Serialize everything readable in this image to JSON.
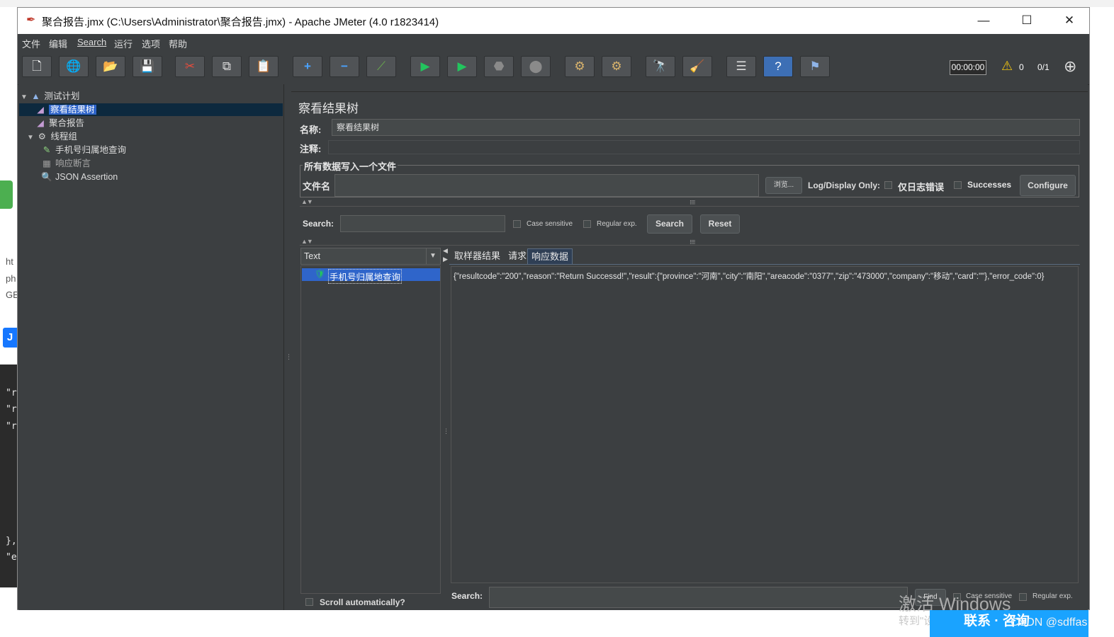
{
  "window": {
    "title": "聚合报告.jmx (C:\\Users\\Administrator\\聚合报告.jmx) - Apache JMeter (4.0 r1823414)",
    "controls": {
      "minimize": "—",
      "maximize": "☐",
      "close": "✕"
    }
  },
  "menu": [
    "文件",
    "编辑",
    "Search",
    "运行",
    "选项",
    "帮助"
  ],
  "toolbar": {
    "buttons": [
      {
        "name": "new-icon",
        "glyph": "🗋"
      },
      {
        "name": "templates-icon",
        "glyph": "🌐"
      },
      {
        "name": "open-icon",
        "glyph": "📂"
      },
      {
        "name": "save-icon",
        "glyph": "💾"
      },
      {
        "name": "cut-icon",
        "glyph": "✂"
      },
      {
        "name": "copy-icon",
        "glyph": "⧉"
      },
      {
        "name": "paste-icon",
        "glyph": "📋"
      },
      {
        "name": "expand-icon",
        "glyph": "+"
      },
      {
        "name": "collapse-icon",
        "glyph": "−"
      },
      {
        "name": "toggle-icon",
        "glyph": "⟋"
      },
      {
        "name": "start-icon",
        "glyph": "▶"
      },
      {
        "name": "start-no-pauses-icon",
        "glyph": "▶"
      },
      {
        "name": "stop-icon",
        "glyph": "⬣"
      },
      {
        "name": "shutdown-icon",
        "glyph": "⬤"
      },
      {
        "name": "clear-icon",
        "glyph": "⚙"
      },
      {
        "name": "clear-all-icon",
        "glyph": "⚙"
      },
      {
        "name": "search-icon",
        "glyph": "🔭"
      },
      {
        "name": "reset-search-icon",
        "glyph": "🧹"
      },
      {
        "name": "function-helper-icon",
        "glyph": "☰"
      },
      {
        "name": "help-icon",
        "glyph": "?"
      },
      {
        "name": "remote-icon",
        "glyph": "⚑"
      }
    ],
    "timer": "00:00:00",
    "warnings": "0",
    "threads": "0/1"
  },
  "tree": [
    {
      "label": "测试计划",
      "icon": "test-plan-icon",
      "glyph": "▲",
      "level": 0,
      "toggle": "▼"
    },
    {
      "label": "察看结果树",
      "icon": "listener-icon",
      "glyph": "◢",
      "level": 1,
      "selected": true
    },
    {
      "label": "聚合报告",
      "icon": "listener-icon",
      "glyph": "◢",
      "level": 1
    },
    {
      "label": "线程组",
      "icon": "thread-group-icon",
      "glyph": "⚙",
      "level": 1,
      "toggle": "▼"
    },
    {
      "label": "手机号归属地查询",
      "icon": "http-sampler-icon",
      "glyph": "✎",
      "level": 2
    },
    {
      "label": "响应断言",
      "icon": "assertion-icon",
      "glyph": "▦",
      "level": 2
    },
    {
      "label": "JSON Assertion",
      "icon": "json-assertion-icon",
      "glyph": "🔍",
      "level": 2
    }
  ],
  "panel": {
    "title": "察看结果树",
    "name_label": "名称:",
    "name_value": "察看结果树",
    "comment_label": "注释:",
    "file_group_title": "所有数据写入一个文件",
    "file_label": "文件名",
    "browse": "浏览...",
    "log_display_only": "Log/Display Only:",
    "errors_only": "仅日志错误",
    "successes": "Successes",
    "configure": "Configure"
  },
  "search": {
    "label": "Search:",
    "case_sensitive": "Case sensitive",
    "regular_exp": "Regular exp.",
    "search_btn": "Search",
    "reset_btn": "Reset"
  },
  "results": {
    "renderer": "Text",
    "sample": "手机号归属地查询",
    "scroll_auto": "Scroll automatically?",
    "tabs": [
      "取样器结果",
      "请求",
      "响应数据"
    ],
    "active_tab": 2,
    "response": "{\"resultcode\":\"200\",\"reason\":\"Return Successd!\",\"result\":{\"province\":\"河南\",\"city\":\"南阳\",\"areacode\":\"0377\",\"zip\":\"473000\",\"company\":\"移动\",\"card\":\"\"},\"error_code\":0}",
    "bottom_search_label": "Search:",
    "find": "Find",
    "case_sensitive": "Case sensitive",
    "regular_exp": "Regular exp."
  },
  "background": {
    "left_text": [
      "ht",
      "ph",
      "GE"
    ],
    "blue_badge": "J",
    "code_lines": [
      "\"r",
      "\"r",
      "\"r",
      "},",
      "\"e"
    ]
  },
  "overlay": {
    "activate_windows": "激活 Windows",
    "activate_hint": "转到\"设置\"以激活 Windows。",
    "contact": "联系 · 咨询",
    "watermark": "CSDN @sdffas"
  }
}
